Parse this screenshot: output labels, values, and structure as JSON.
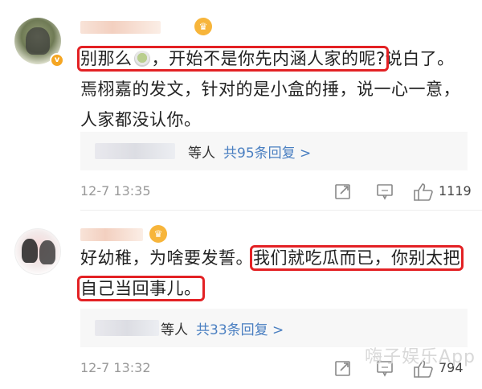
{
  "comments": [
    {
      "text_highlight": "别那么",
      "text_highlight_rest": "，开始不是你先内涵人家的呢?",
      "text_after": "说白了。焉栩嘉的发文，针对的是小盒的捶，说一心一意，人家都没认你。",
      "replies": {
        "label": "等人",
        "link": "共95条回复 >"
      },
      "time": "12-7 13:35",
      "likes": "1119"
    },
    {
      "text_before": "好幼稚，为啥要发誓。",
      "text_highlight": "我们就吃瓜而已，你别太把自己当回事儿。",
      "replies": {
        "label": "等人",
        "link": "共33条回复 >"
      },
      "time": "12-7 13:32",
      "likes": "794"
    }
  ],
  "watermark": "嗨子娱乐App",
  "colors": {
    "highlight": "#e32124",
    "link": "#4a7fc1",
    "meta": "#999999"
  },
  "icons": [
    "vip-badge-icon",
    "crown-icon",
    "tea-emoji-icon",
    "share-icon",
    "comment-icon",
    "like-icon"
  ]
}
